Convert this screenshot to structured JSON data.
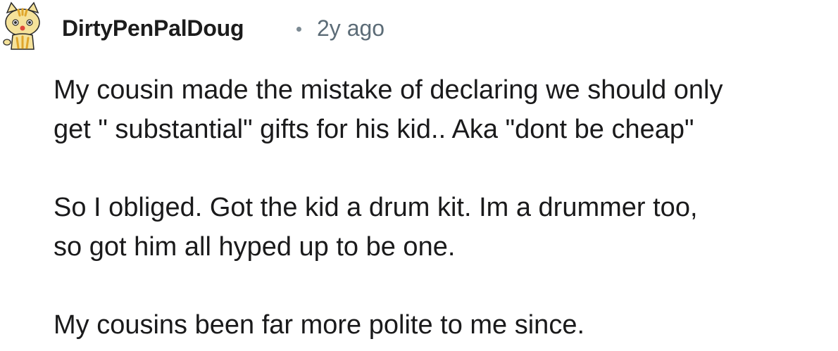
{
  "comment": {
    "author": "DirtyPenPalDoug",
    "separator": "•",
    "age": "2y ago",
    "avatar_icon": "snoo-cat-avatar-icon",
    "paragraphs": [
      "My cousin made the mistake of declaring we should only\nget \" substantial\" gifts for his kid.. Aka \"dont be cheap\"",
      "So I obliged. Got the kid a drum kit. Im a drummer too,\nso got him all hyped up to be one.",
      "My cousins been far more polite to me since."
    ]
  },
  "colors": {
    "text": "#1a1a1b",
    "meta": "#5c6c77",
    "avatar_body": "#f5e29a",
    "avatar_stripe": "#e0a62b"
  }
}
